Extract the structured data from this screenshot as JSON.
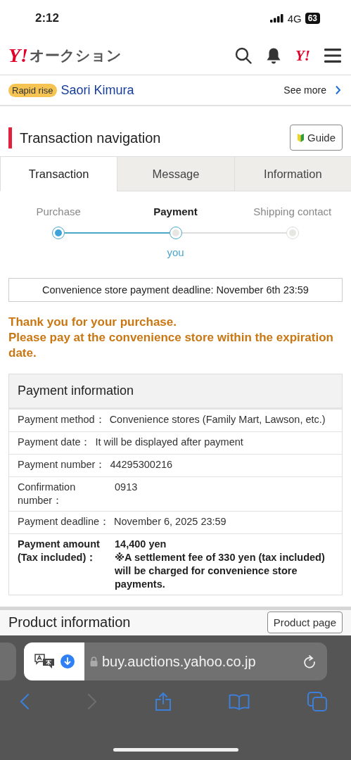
{
  "status_bar": {
    "time": "2:12",
    "network": "4G",
    "battery": "63"
  },
  "header": {
    "logo_mark": "Y!",
    "logo_text": "オークション",
    "account_mark": "Y!"
  },
  "promo": {
    "badge": "Rapid rise",
    "name": "Saori Kimura",
    "link": "See more"
  },
  "section": {
    "title": "Transaction navigation",
    "button": "Guide"
  },
  "tabs": [
    {
      "label": "Transaction",
      "selected": true
    },
    {
      "label": "Message",
      "selected": false
    },
    {
      "label": "Information",
      "selected": false
    }
  ],
  "steps": [
    {
      "label": "Purchase",
      "done": true,
      "selected": false
    },
    {
      "label": "Payment",
      "done": false,
      "selected": true,
      "note": "you"
    },
    {
      "label": "Shipping contact",
      "done": false,
      "selected": false
    }
  ],
  "deadline_notice": "Convenience store payment deadline: November 6th 23:59",
  "message": [
    "Thank you for your purchase.",
    "Please pay at the convenience store within the expiration date."
  ],
  "payment_info": {
    "title": "Payment information",
    "rows": [
      {
        "label": "Payment method：",
        "value": [
          "Convenience stores (Family Mart, Lawson, etc.)"
        ],
        "bold": false
      },
      {
        "label": "Payment date：",
        "value": [
          "It will be displayed after payment"
        ],
        "bold": false
      },
      {
        "label": "Payment number：",
        "value": [
          "44295300216"
        ],
        "bold": false
      },
      {
        "label": "Confirmation number：",
        "value": [
          "0913"
        ],
        "bold": false
      },
      {
        "label": "Payment deadline：",
        "value": [
          "November 6, 2025 23:59"
        ],
        "bold": false
      },
      {
        "label": "Payment amount (Tax included)：",
        "value": [
          "14,400 yen",
          "※A settlement fee of 330 yen (tax included) will be charged for convenience store payments."
        ],
        "bold": true
      }
    ]
  },
  "product_info": {
    "title": "Product information",
    "button": "Product page"
  },
  "browser": {
    "url": "buy.auctions.yahoo.co.jp"
  }
}
